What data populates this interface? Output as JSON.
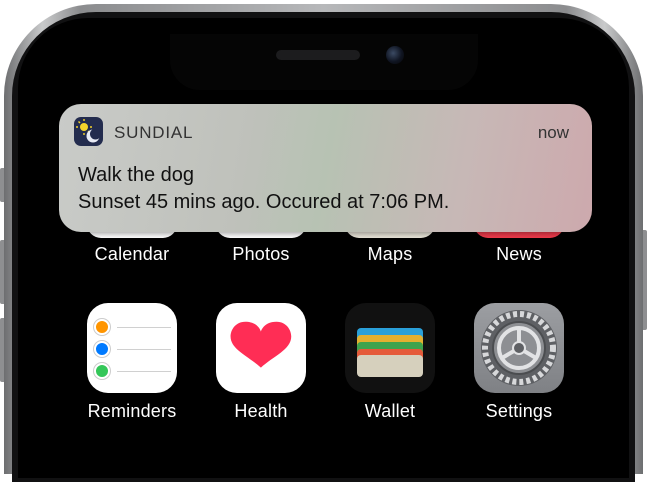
{
  "notification": {
    "app_name": "SUNDIAL",
    "time": "now",
    "title": "Walk the dog",
    "body": "Sunset 45 mins ago. Occured at 7:06 PM."
  },
  "dock_row_1": [
    {
      "label": "Calendar"
    },
    {
      "label": "Photos"
    },
    {
      "label": "Maps"
    },
    {
      "label": "News"
    }
  ],
  "apps_row_2": [
    {
      "label": "Reminders",
      "icon": "reminders-icon"
    },
    {
      "label": "Health",
      "icon": "heart-icon"
    },
    {
      "label": "Wallet",
      "icon": "wallet-icon"
    },
    {
      "label": "Settings",
      "icon": "gear-icon"
    }
  ],
  "colors": {
    "health_heart": "#ff2d55",
    "reminders_dots": [
      "#ff9500",
      "#007aff",
      "#34c759"
    ],
    "wallet_cards": [
      "#2aa0d9",
      "#e3b030",
      "#3fa34d",
      "#e55a3a"
    ]
  }
}
